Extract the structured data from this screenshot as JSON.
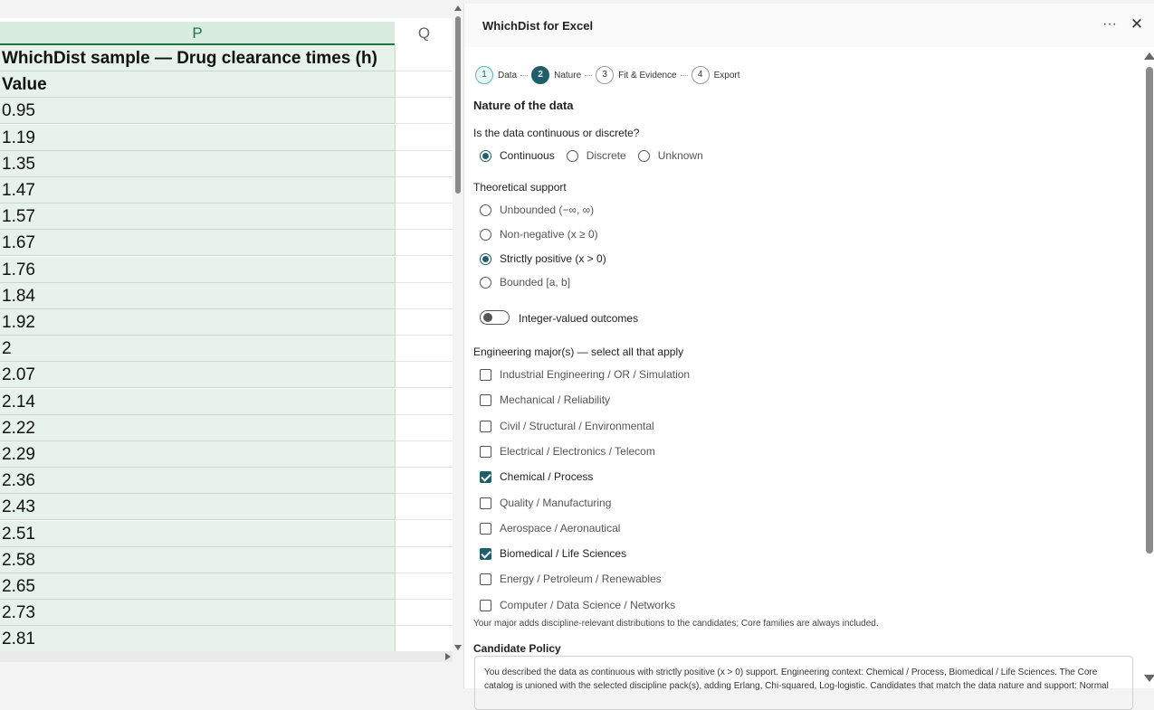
{
  "sheet": {
    "columns": [
      "P",
      "Q"
    ],
    "rows": [
      {
        "value": "WhichDist sample — Drug clearance times (h)",
        "bold": true
      },
      {
        "value": "Value",
        "bold": true
      },
      {
        "value": "0.95"
      },
      {
        "value": "1.19"
      },
      {
        "value": "1.35"
      },
      {
        "value": "1.47"
      },
      {
        "value": "1.57"
      },
      {
        "value": "1.67"
      },
      {
        "value": "1.76"
      },
      {
        "value": "1.84"
      },
      {
        "value": "1.92"
      },
      {
        "value": "2"
      },
      {
        "value": "2.07"
      },
      {
        "value": "2.14"
      },
      {
        "value": "2.22"
      },
      {
        "value": "2.29"
      },
      {
        "value": "2.36"
      },
      {
        "value": "2.43"
      },
      {
        "value": "2.51"
      },
      {
        "value": "2.58"
      },
      {
        "value": "2.65"
      },
      {
        "value": "2.73"
      },
      {
        "value": "2.81"
      }
    ]
  },
  "pane": {
    "title": "WhichDist for Excel",
    "more_label": "···",
    "close_label": "✕",
    "steps": [
      {
        "num": "1",
        "label": "Data",
        "state": "done"
      },
      {
        "num": "2",
        "label": "Nature",
        "state": "active"
      },
      {
        "num": "3",
        "label": "Fit & Evidence",
        "state": "todo"
      },
      {
        "num": "4",
        "label": "Export",
        "state": "todo"
      }
    ],
    "section_title": "Nature of the data",
    "continuity": {
      "question": "Is the data continuous or discrete?",
      "options": [
        {
          "label": "Continuous",
          "checked": true
        },
        {
          "label": "Discrete",
          "checked": false
        },
        {
          "label": "Unknown",
          "checked": false
        }
      ]
    },
    "support": {
      "question": "Theoretical support",
      "options": [
        {
          "label": "Unbounded (−∞, ∞)",
          "checked": false
        },
        {
          "label": "Non-negative (x ≥ 0)",
          "checked": false
        },
        {
          "label": "Strictly positive (x > 0)",
          "checked": true
        },
        {
          "label": "Bounded [a, b]",
          "checked": false
        }
      ]
    },
    "integer_toggle": {
      "label": "Integer-valued outcomes",
      "on": false
    },
    "majors": {
      "question": "Engineering major(s) — select all that apply",
      "options": [
        {
          "label": "Industrial Engineering / OR / Simulation",
          "checked": false
        },
        {
          "label": "Mechanical / Reliability",
          "checked": false
        },
        {
          "label": "Civil / Structural / Environmental",
          "checked": false
        },
        {
          "label": "Electrical / Electronics / Telecom",
          "checked": false
        },
        {
          "label": "Chemical / Process",
          "checked": true
        },
        {
          "label": "Quality / Manufacturing",
          "checked": false
        },
        {
          "label": "Aerospace / Aeronautical",
          "checked": false
        },
        {
          "label": "Biomedical / Life Sciences",
          "checked": true
        },
        {
          "label": "Energy / Petroleum / Renewables",
          "checked": false
        },
        {
          "label": "Computer / Data Science / Networks",
          "checked": false
        }
      ],
      "hint": "Your major adds discipline-relevant distributions to the candidates; Core families are always included."
    },
    "policy": {
      "title": "Candidate Policy",
      "text": "You described the data as continuous with strictly positive (x > 0) support. Engineering context: Chemical / Process, Biomedical / Life Sciences. The Core catalog is unioned with the selected discipline pack(s), adding Erlang, Chi-squared, Log-logistic. Candidates that match the data nature and support: Normal"
    }
  },
  "colors": {
    "accent": "#1f5f6c",
    "sheet_selected": "#e6f2ea",
    "sheet_header_text": "#217346"
  }
}
